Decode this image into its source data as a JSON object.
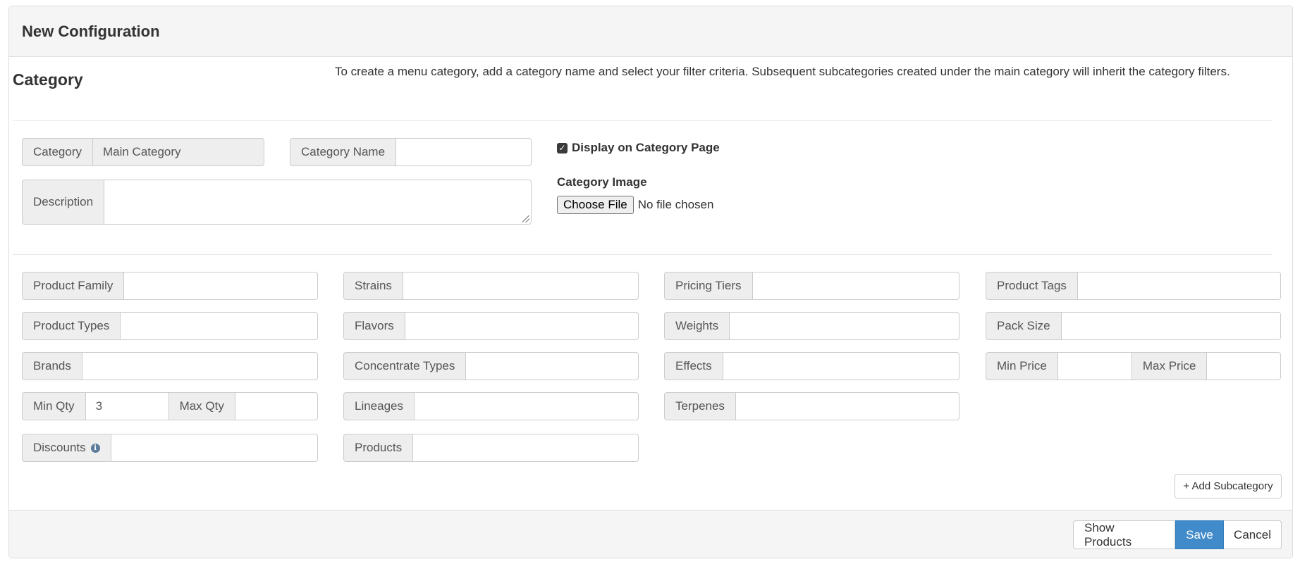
{
  "header": {
    "title": "New Configuration"
  },
  "section": {
    "title": "Category",
    "help_text": "To create a menu category, add a category name and select your filter criteria. Subsequent subcategories created under the main category will inherit the category filters."
  },
  "basic": {
    "category_label": "Category",
    "category_value": "Main Category",
    "category_name_label": "Category Name",
    "category_name_value": "",
    "description_label": "Description",
    "description_value": "",
    "display_on_page_label": "Display on Category Page",
    "display_on_page_checked": true,
    "check_glyph": "✓",
    "category_image_label": "Category Image",
    "choose_file_label": "Choose File",
    "no_file_text": "No file chosen"
  },
  "filters": {
    "product_family": "Product Family",
    "strains": "Strains",
    "pricing_tiers": "Pricing Tiers",
    "product_tags": "Product Tags",
    "product_types": "Product Types",
    "flavors": "Flavors",
    "weights": "Weights",
    "pack_size": "Pack Size",
    "brands": "Brands",
    "concentrate_types": "Concentrate Types",
    "effects": "Effects",
    "min_price": "Min Price",
    "max_price": "Max Price",
    "min_qty": "Min Qty",
    "min_qty_value": "3",
    "max_qty": "Max Qty",
    "lineages": "Lineages",
    "terpenes": "Terpenes",
    "discounts": "Discounts",
    "products": "Products",
    "info_glyph": "i"
  },
  "actions": {
    "add_subcategory": "+ Add Subcategory",
    "show_products": "Show Products",
    "save": "Save",
    "cancel": "Cancel"
  },
  "colors": {
    "primary": "#428bca",
    "addon_bg": "#eeeeee",
    "border": "#cccccc"
  }
}
